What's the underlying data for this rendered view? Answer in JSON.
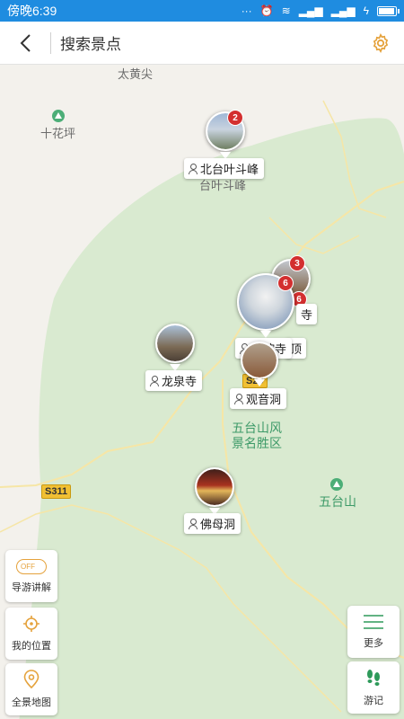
{
  "status_bar": {
    "time": "傍晚6:39"
  },
  "header": {
    "search_placeholder": "搜索景点"
  },
  "map_labels": {
    "taihuangjian": "太黄尖",
    "shihuaping": "十花坪",
    "beitai_under": "台叶斗峰",
    "scenic_area_line1": "五台山风",
    "scenic_area_line2": "景名胜区",
    "wutaishan": "五台山",
    "road_s311": "S311",
    "road_s20": "S20"
  },
  "markers": [
    {
      "label": "北台叶斗峰",
      "badge": "2",
      "color": "#7a8ea8"
    },
    {
      "label": "塔院寺",
      "badge": "6",
      "color": "#8da7c4"
    },
    {
      "label": "龙泉寺",
      "badge": "",
      "color": "#7b6a55"
    },
    {
      "label": "观音洞",
      "badge": "",
      "color": "#8a5a3a"
    },
    {
      "label": "佛母洞",
      "badge": "",
      "color": "#6b3b2b"
    }
  ],
  "partial_markers": {
    "badge_a": "3",
    "badge_b": "6",
    "text_a": "寺",
    "text_b": "顶"
  },
  "controls": {
    "guide_toggle_state": "OFF",
    "guide": "导游讲解",
    "my_location": "我的位置",
    "full_map": "全景地图",
    "more": "更多",
    "travel_notes": "游记"
  },
  "colors": {
    "accent": "#1f8ce0",
    "badge": "#d32f2f",
    "icon_orange": "#e5a23c",
    "icon_green": "#2e9a5a",
    "scenic_area": "#d9ead0"
  }
}
